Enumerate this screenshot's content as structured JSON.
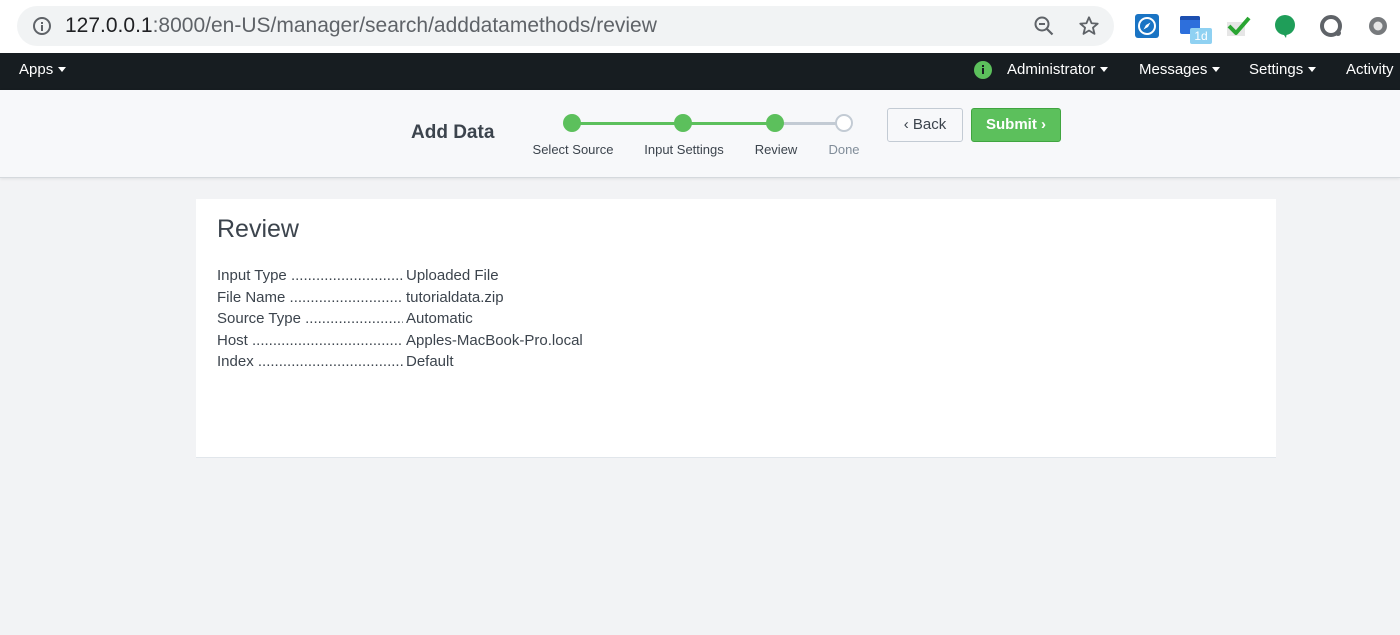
{
  "browser": {
    "url_host": "127.0.0.1",
    "url_rest": ":8000/en-US/manager/search/adddatamethods/review",
    "ext_badge": "1d"
  },
  "nav": {
    "apps_label": "Apps",
    "user_label": "Administrator",
    "messages_label": "Messages",
    "settings_label": "Settings",
    "activity_label": "Activity"
  },
  "wizard": {
    "title": "Add Data",
    "steps": [
      {
        "label": "Select Source",
        "state": "complete"
      },
      {
        "label": "Input Settings",
        "state": "complete"
      },
      {
        "label": "Review",
        "state": "current"
      },
      {
        "label": "Done",
        "state": "pending"
      }
    ],
    "back_label": "Back",
    "submit_label": "Submit"
  },
  "review": {
    "title": "Review",
    "rows": [
      {
        "key": "Input Type",
        "value": "Uploaded File"
      },
      {
        "key": "File Name",
        "value": "tutorialdata.zip"
      },
      {
        "key": "Source Type",
        "value": "Automatic"
      },
      {
        "key": "Host",
        "value": "Apples-MacBook-Pro.local"
      },
      {
        "key": "Index",
        "value": "Default"
      }
    ]
  },
  "colors": {
    "accent_green": "#5cc05c",
    "nav_bg": "#171d21",
    "pending_gray": "#c3cbd4"
  },
  "icons": [
    "info-icon",
    "zoom-out-icon",
    "star-icon",
    "compass-icon",
    "calendar-icon",
    "checkmark-icon",
    "chat-bubble-icon",
    "circle-icon",
    "ring-icon",
    "status-info-icon",
    "chevron-left-icon",
    "chevron-right-icon"
  ]
}
